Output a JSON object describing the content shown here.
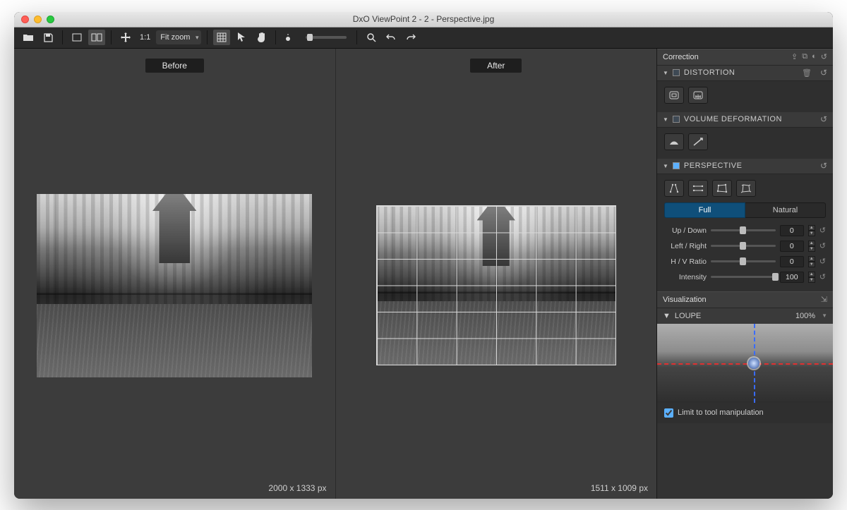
{
  "window": {
    "title": "DxO ViewPoint 2 - 2 - Perspective.jpg"
  },
  "toolbar": {
    "zoom_ratio": "1:1",
    "zoom_select": "Fit zoom"
  },
  "viewer": {
    "before_label": "Before",
    "after_label": "After",
    "before_dim": "2000 x 1333 px",
    "after_dim": "1511 x 1009 px"
  },
  "sidebar": {
    "correction_title": "Correction",
    "distortion": {
      "title": "DISTORTION"
    },
    "volume": {
      "title": "VOLUME DEFORMATION"
    },
    "perspective": {
      "title": "PERSPECTIVE",
      "seg_full": "Full",
      "seg_natural": "Natural",
      "sliders": [
        {
          "label": "Up / Down",
          "value": "0",
          "pos": 50
        },
        {
          "label": "Left / Right",
          "value": "0",
          "pos": 50
        },
        {
          "label": "H / V Ratio",
          "value": "0",
          "pos": 50
        },
        {
          "label": "Intensity",
          "value": "100",
          "pos": 100
        }
      ]
    },
    "visualization_title": "Visualization",
    "loupe": {
      "title": "LOUPE",
      "zoom": "100%"
    },
    "limit_label": "Limit to tool manipulation"
  }
}
